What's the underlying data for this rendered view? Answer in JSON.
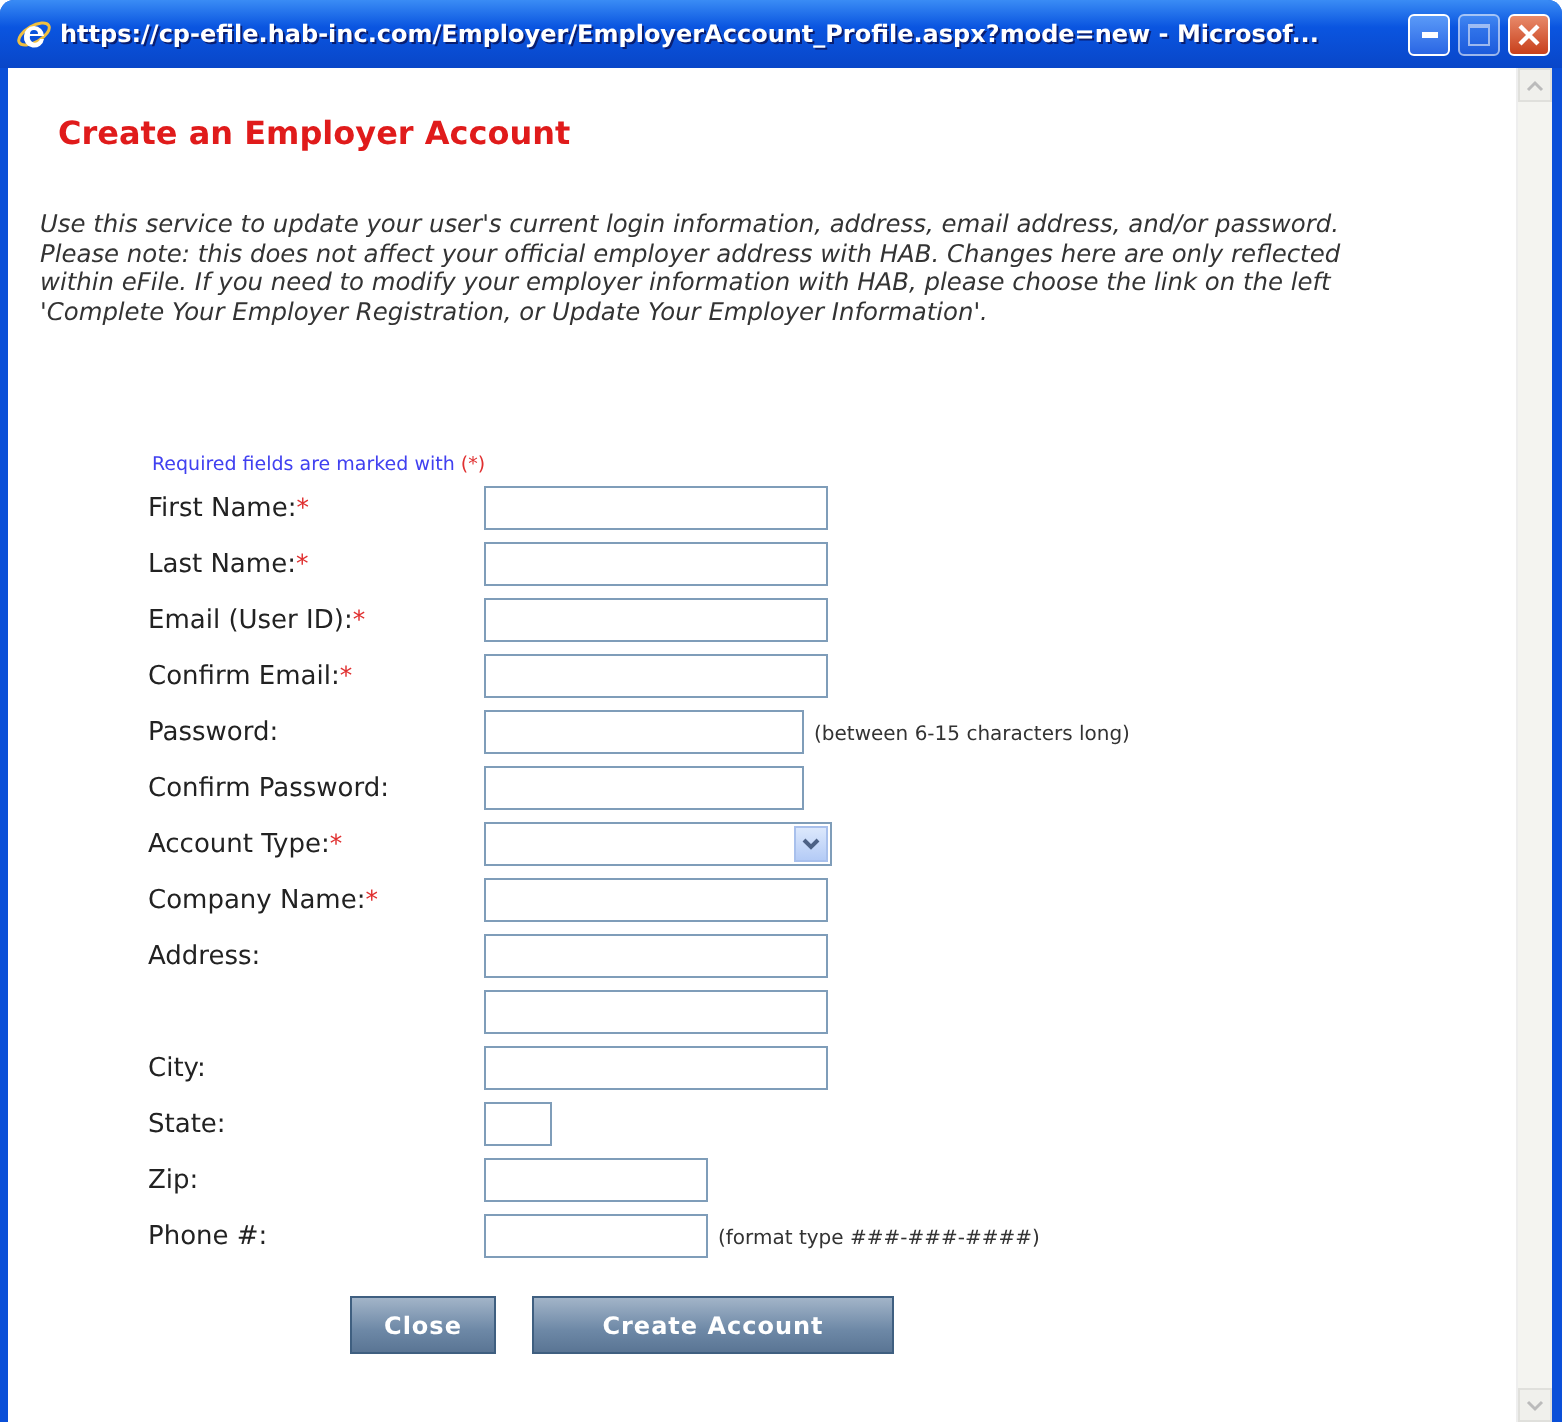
{
  "window": {
    "title": "https://cp-efile.hab-inc.com/Employer/EmployerAccount_Profile.aspx?mode=new - Microsof..."
  },
  "heading": "Create an Employer Account",
  "intro": "Use this service to update your user's current login information, address, email address, and/or password. Please note: this does not affect your official employer address with HAB. Changes here are only reflected within eFile. If you need to modify your employer information with HAB, please choose the link on the left 'Complete Your Employer Registration, or Update Your Employer Information'.",
  "required_note": {
    "text": "Required fields are marked with",
    "mark": "(*)"
  },
  "fields": [
    {
      "label": "First Name:",
      "mark": "*",
      "kind": "wide"
    },
    {
      "label": "Last Name:",
      "mark": "*",
      "kind": "wide"
    },
    {
      "label": "Email (User ID):",
      "mark": "*",
      "kind": "wide"
    },
    {
      "label": "Confirm Email:",
      "mark": "*",
      "kind": "wide"
    },
    {
      "label": "Password:",
      "kind": "medium",
      "hint": "(between 6-15 characters long)"
    },
    {
      "label": "Confirm Password:",
      "kind": "medium"
    },
    {
      "label": "Account Type:",
      "mark": "*",
      "kind": "select"
    },
    {
      "label": "Company Name:",
      "mark": "*",
      "kind": "wide"
    },
    {
      "label": "Address:",
      "kind": "wide"
    },
    {
      "kind": "wide"
    },
    {
      "label": "City:",
      "kind": "wide"
    },
    {
      "label": "State:",
      "kind": "tiny"
    },
    {
      "label": "Zip:",
      "kind": "narrow"
    },
    {
      "label": "Phone #:",
      "kind": "narrow",
      "hint": "(format type ###-###-####)"
    }
  ],
  "buttons": [
    "Close",
    "Create Account"
  ]
}
